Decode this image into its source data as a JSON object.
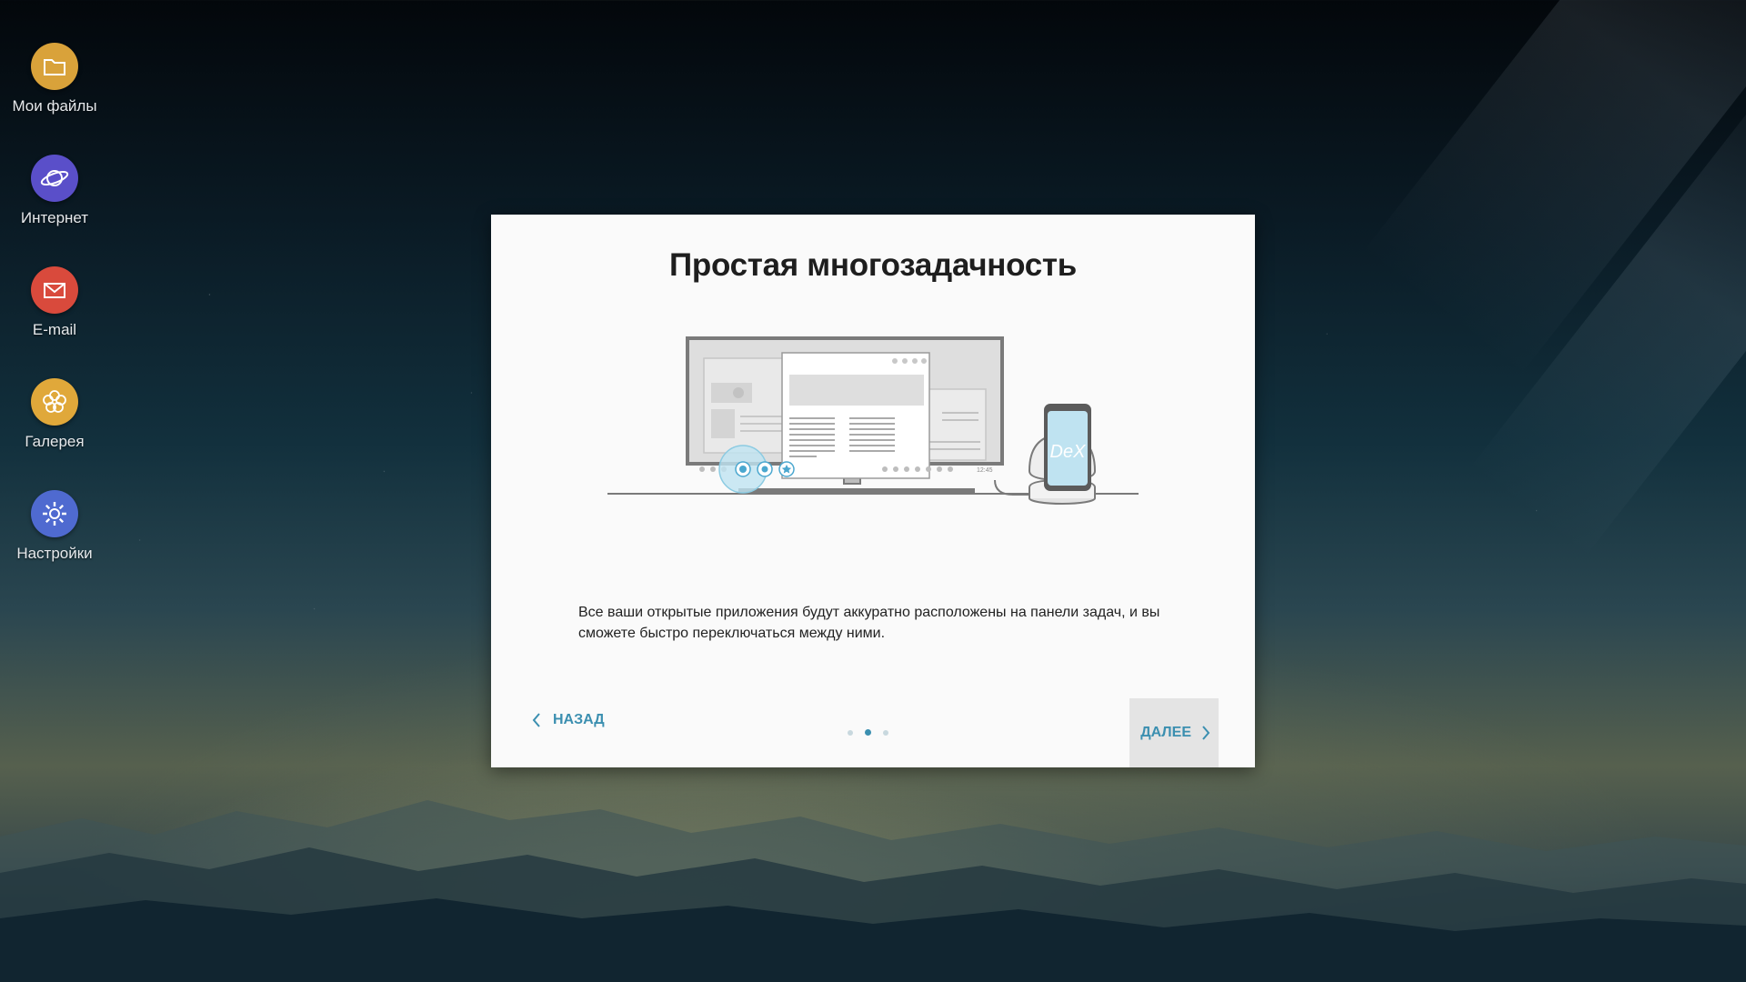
{
  "desktop": {
    "icons": [
      {
        "label": "Мои файлы",
        "icon": "folder-icon",
        "color": "#d9a23a"
      },
      {
        "label": "Интернет",
        "icon": "planet-icon",
        "color": "#5a4fc9"
      },
      {
        "label": "E-mail",
        "icon": "mail-icon",
        "color": "#d94a3c"
      },
      {
        "label": "Галерея",
        "icon": "flower-icon",
        "color": "#e0a83a"
      },
      {
        "label": "Настройки",
        "icon": "gear-icon",
        "color": "#4f6ad0"
      }
    ]
  },
  "dialog": {
    "title": "Простая многозадачность",
    "description": "Все ваши открытые приложения будут аккуратно расположены на панели задач, и вы сможете быстро переключаться между ними.",
    "illustration": {
      "clock": "12:45",
      "phone_logo": "DeX"
    },
    "back_label": "НАЗАД",
    "next_label": "ДАЛЕЕ",
    "pager": {
      "total": 3,
      "current": 2
    },
    "accent": "#3b8fb0"
  }
}
